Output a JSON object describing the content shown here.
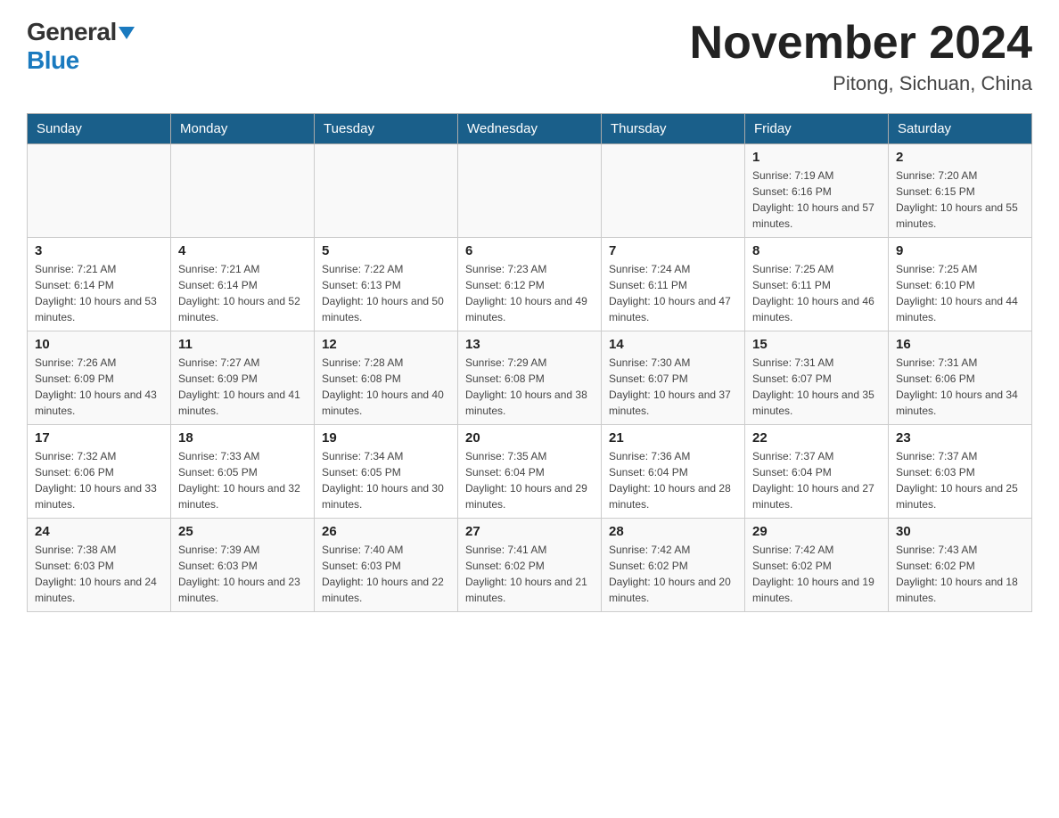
{
  "logo": {
    "general": "General",
    "blue": "Blue"
  },
  "title": {
    "month": "November 2024",
    "location": "Pitong, Sichuan, China"
  },
  "weekdays": [
    "Sunday",
    "Monday",
    "Tuesday",
    "Wednesday",
    "Thursday",
    "Friday",
    "Saturday"
  ],
  "weeks": [
    [
      {
        "day": "",
        "info": ""
      },
      {
        "day": "",
        "info": ""
      },
      {
        "day": "",
        "info": ""
      },
      {
        "day": "",
        "info": ""
      },
      {
        "day": "",
        "info": ""
      },
      {
        "day": "1",
        "info": "Sunrise: 7:19 AM\nSunset: 6:16 PM\nDaylight: 10 hours and 57 minutes."
      },
      {
        "day": "2",
        "info": "Sunrise: 7:20 AM\nSunset: 6:15 PM\nDaylight: 10 hours and 55 minutes."
      }
    ],
    [
      {
        "day": "3",
        "info": "Sunrise: 7:21 AM\nSunset: 6:14 PM\nDaylight: 10 hours and 53 minutes."
      },
      {
        "day": "4",
        "info": "Sunrise: 7:21 AM\nSunset: 6:14 PM\nDaylight: 10 hours and 52 minutes."
      },
      {
        "day": "5",
        "info": "Sunrise: 7:22 AM\nSunset: 6:13 PM\nDaylight: 10 hours and 50 minutes."
      },
      {
        "day": "6",
        "info": "Sunrise: 7:23 AM\nSunset: 6:12 PM\nDaylight: 10 hours and 49 minutes."
      },
      {
        "day": "7",
        "info": "Sunrise: 7:24 AM\nSunset: 6:11 PM\nDaylight: 10 hours and 47 minutes."
      },
      {
        "day": "8",
        "info": "Sunrise: 7:25 AM\nSunset: 6:11 PM\nDaylight: 10 hours and 46 minutes."
      },
      {
        "day": "9",
        "info": "Sunrise: 7:25 AM\nSunset: 6:10 PM\nDaylight: 10 hours and 44 minutes."
      }
    ],
    [
      {
        "day": "10",
        "info": "Sunrise: 7:26 AM\nSunset: 6:09 PM\nDaylight: 10 hours and 43 minutes."
      },
      {
        "day": "11",
        "info": "Sunrise: 7:27 AM\nSunset: 6:09 PM\nDaylight: 10 hours and 41 minutes."
      },
      {
        "day": "12",
        "info": "Sunrise: 7:28 AM\nSunset: 6:08 PM\nDaylight: 10 hours and 40 minutes."
      },
      {
        "day": "13",
        "info": "Sunrise: 7:29 AM\nSunset: 6:08 PM\nDaylight: 10 hours and 38 minutes."
      },
      {
        "day": "14",
        "info": "Sunrise: 7:30 AM\nSunset: 6:07 PM\nDaylight: 10 hours and 37 minutes."
      },
      {
        "day": "15",
        "info": "Sunrise: 7:31 AM\nSunset: 6:07 PM\nDaylight: 10 hours and 35 minutes."
      },
      {
        "day": "16",
        "info": "Sunrise: 7:31 AM\nSunset: 6:06 PM\nDaylight: 10 hours and 34 minutes."
      }
    ],
    [
      {
        "day": "17",
        "info": "Sunrise: 7:32 AM\nSunset: 6:06 PM\nDaylight: 10 hours and 33 minutes."
      },
      {
        "day": "18",
        "info": "Sunrise: 7:33 AM\nSunset: 6:05 PM\nDaylight: 10 hours and 32 minutes."
      },
      {
        "day": "19",
        "info": "Sunrise: 7:34 AM\nSunset: 6:05 PM\nDaylight: 10 hours and 30 minutes."
      },
      {
        "day": "20",
        "info": "Sunrise: 7:35 AM\nSunset: 6:04 PM\nDaylight: 10 hours and 29 minutes."
      },
      {
        "day": "21",
        "info": "Sunrise: 7:36 AM\nSunset: 6:04 PM\nDaylight: 10 hours and 28 minutes."
      },
      {
        "day": "22",
        "info": "Sunrise: 7:37 AM\nSunset: 6:04 PM\nDaylight: 10 hours and 27 minutes."
      },
      {
        "day": "23",
        "info": "Sunrise: 7:37 AM\nSunset: 6:03 PM\nDaylight: 10 hours and 25 minutes."
      }
    ],
    [
      {
        "day": "24",
        "info": "Sunrise: 7:38 AM\nSunset: 6:03 PM\nDaylight: 10 hours and 24 minutes."
      },
      {
        "day": "25",
        "info": "Sunrise: 7:39 AM\nSunset: 6:03 PM\nDaylight: 10 hours and 23 minutes."
      },
      {
        "day": "26",
        "info": "Sunrise: 7:40 AM\nSunset: 6:03 PM\nDaylight: 10 hours and 22 minutes."
      },
      {
        "day": "27",
        "info": "Sunrise: 7:41 AM\nSunset: 6:02 PM\nDaylight: 10 hours and 21 minutes."
      },
      {
        "day": "28",
        "info": "Sunrise: 7:42 AM\nSunset: 6:02 PM\nDaylight: 10 hours and 20 minutes."
      },
      {
        "day": "29",
        "info": "Sunrise: 7:42 AM\nSunset: 6:02 PM\nDaylight: 10 hours and 19 minutes."
      },
      {
        "day": "30",
        "info": "Sunrise: 7:43 AM\nSunset: 6:02 PM\nDaylight: 10 hours and 18 minutes."
      }
    ]
  ]
}
